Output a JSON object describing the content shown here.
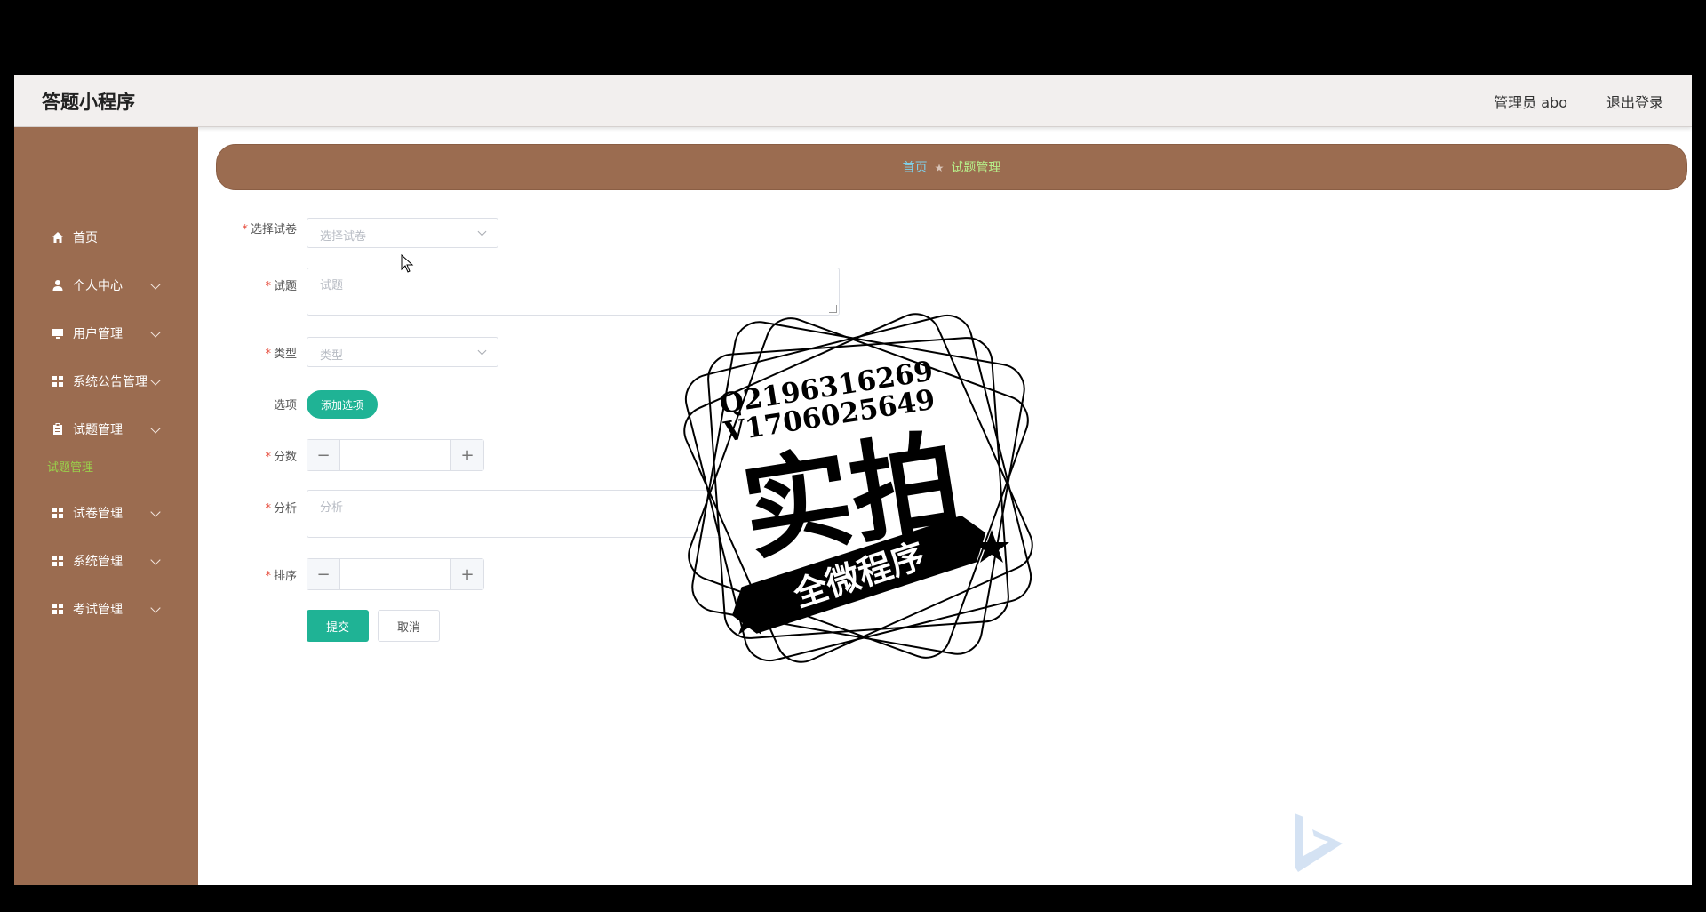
{
  "app": {
    "title": "答题小程序",
    "admin_label": "管理员 abo",
    "logout_label": "退出登录"
  },
  "sidebar": {
    "items": [
      {
        "label": "首页",
        "icon": "home-icon"
      },
      {
        "label": "个人中心",
        "icon": "user-icon"
      },
      {
        "label": "用户管理",
        "icon": "monitor-icon"
      },
      {
        "label": "系统公告管理",
        "icon": "grid-icon"
      },
      {
        "label": "试题管理",
        "icon": "clipboard-icon"
      },
      {
        "label": "试卷管理",
        "icon": "grid-icon"
      },
      {
        "label": "系统管理",
        "icon": "grid-icon"
      },
      {
        "label": "考试管理",
        "icon": "grid-icon"
      }
    ],
    "active_sub": "试题管理"
  },
  "breadcrumb": {
    "home": "首页",
    "current": "试题管理"
  },
  "form": {
    "paper": {
      "label": "选择试卷",
      "placeholder": "选择试卷"
    },
    "question": {
      "label": "试题",
      "placeholder": "试题"
    },
    "type": {
      "label": "类型",
      "placeholder": "类型"
    },
    "options": {
      "label": "选项",
      "button": "添加选项"
    },
    "score": {
      "label": "分数",
      "minus": "−",
      "plus": "+"
    },
    "analysis": {
      "label": "分析",
      "placeholder": "分析"
    },
    "order": {
      "label": "排序",
      "minus": "−",
      "plus": "+"
    },
    "submit": "提交",
    "cancel": "取消"
  },
  "watermark": {
    "qq": "Q2196316269",
    "wechat": "V1706025649",
    "big_text": "实拍",
    "ribbon_text": "全微程序"
  },
  "colors": {
    "sidebar_bg": "#9b6c50",
    "accent_green": "#1fb395",
    "active_sub": "#9ad04b"
  }
}
